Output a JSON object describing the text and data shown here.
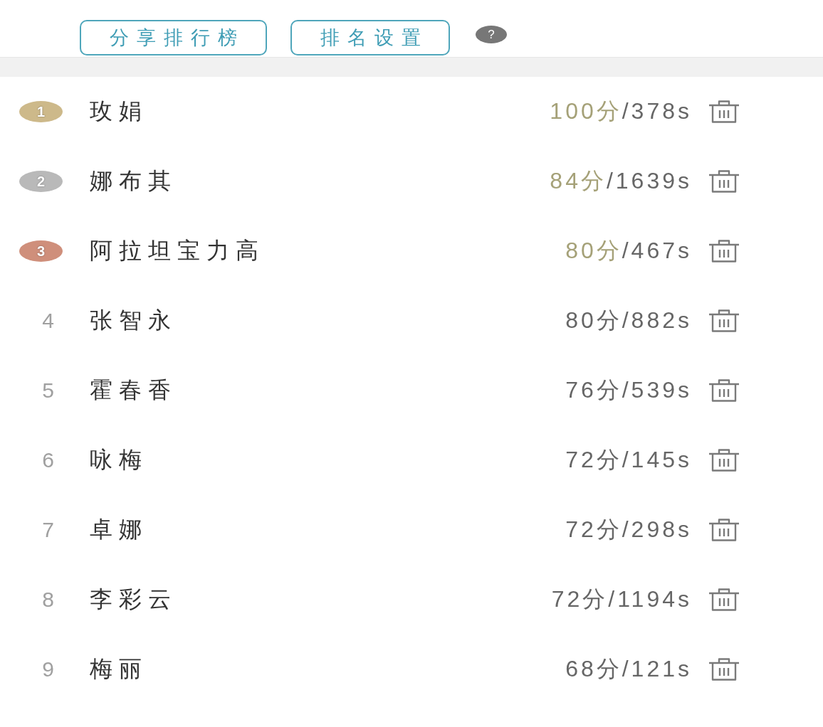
{
  "toolbar": {
    "buttons": [
      {
        "label": "分享排行榜"
      },
      {
        "label": "排名设置"
      }
    ],
    "help_icon": "?"
  },
  "ranking": [
    {
      "rank": "1",
      "kind": "medal",
      "color": "#cdb98a",
      "name": "玫娟",
      "score": "100分",
      "time": "/378s"
    },
    {
      "rank": "2",
      "kind": "medal",
      "color": "#b9b9b9",
      "name": "娜布其",
      "score": "84分",
      "time": "/1639s"
    },
    {
      "rank": "3",
      "kind": "medal",
      "color": "#cf8f7b",
      "name": "阿拉坦宝力高",
      "score": "80分",
      "time": "/467s"
    },
    {
      "rank": "4",
      "kind": "plain",
      "name": "张智永",
      "score": "80分",
      "time": "/882s"
    },
    {
      "rank": "5",
      "kind": "plain",
      "name": "霍春香",
      "score": "76分",
      "time": "/539s"
    },
    {
      "rank": "6",
      "kind": "plain",
      "name": "咏梅",
      "score": "72分",
      "time": "/145s"
    },
    {
      "rank": "7",
      "kind": "plain",
      "name": "卓娜",
      "score": "72分",
      "time": "/298s"
    },
    {
      "rank": "8",
      "kind": "plain",
      "name": "李彩云",
      "score": "72分",
      "time": "/1194s"
    },
    {
      "rank": "9",
      "kind": "plain",
      "name": "梅丽",
      "score": "68分",
      "time": "/121s"
    }
  ]
}
